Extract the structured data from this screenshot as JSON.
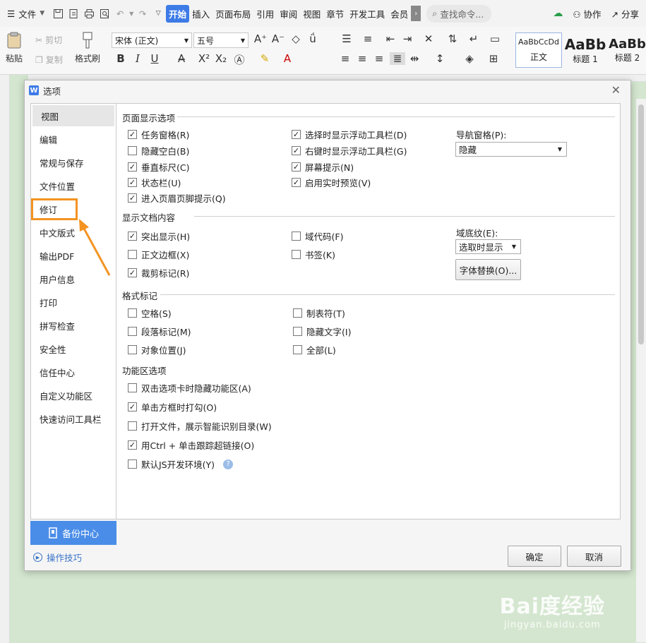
{
  "menubar": {
    "file_label": "文件",
    "tabs": [
      "开始",
      "插入",
      "页面布局",
      "引用",
      "审阅",
      "视图",
      "章节",
      "开发工具",
      "会员"
    ],
    "active_tab": "开始",
    "search_placeholder": "查找命令...",
    "collab_label": "协作",
    "share_label": "分享"
  },
  "ribbon": {
    "paste_label": "粘贴",
    "cut_label": "剪切",
    "copy_label": "复制",
    "format_painter_label": "格式刷",
    "font_family": "宋体 (正文)",
    "font_size": "五号",
    "styles": [
      {
        "preview": "AaBbCcDd",
        "name": "正文"
      },
      {
        "preview": "AaBb",
        "name": "标题 1"
      },
      {
        "preview": "AaBb",
        "name": "标题 2"
      }
    ]
  },
  "dialog": {
    "title": "选项",
    "sidebar": [
      "视图",
      "编辑",
      "常规与保存",
      "文件位置",
      "修订",
      "中文版式",
      "输出PDF",
      "用户信息",
      "打印",
      "拼写检查",
      "安全性",
      "信任中心",
      "自定义功能区",
      "快速访问工具栏"
    ],
    "selected": "视图",
    "backup_label": "备份中心",
    "tips_label": "操作技巧",
    "sections": {
      "page_display": {
        "title": "页面显示选项",
        "col1": [
          {
            "label": "任务窗格(R)",
            "checked": true
          },
          {
            "label": "隐藏空白(B)",
            "checked": false
          },
          {
            "label": "垂直标尺(C)",
            "checked": true
          },
          {
            "label": "状态栏(U)",
            "checked": true
          },
          {
            "label": "进入页眉页脚提示(Q)",
            "checked": true
          }
        ],
        "col2": [
          {
            "label": "选择时显示浮动工具栏(D)",
            "checked": true
          },
          {
            "label": "右键时显示浮动工具栏(G)",
            "checked": true
          },
          {
            "label": "屏幕提示(N)",
            "checked": true
          },
          {
            "label": "启用实时预览(V)",
            "checked": true
          }
        ],
        "nav_label": "导航窗格(P):",
        "nav_value": "隐藏"
      },
      "doc_content": {
        "title": "显示文档内容",
        "col1": [
          {
            "label": "突出显示(H)",
            "checked": true
          },
          {
            "label": "正文边框(X)",
            "checked": false
          },
          {
            "label": "裁剪标记(R)",
            "checked": true
          }
        ],
        "col2": [
          {
            "label": "域代码(F)",
            "checked": false
          },
          {
            "label": "书签(K)",
            "checked": false
          }
        ],
        "shading_label": "域底纹(E):",
        "shading_value": "选取时显示",
        "font_sub_button": "字体替换(O)..."
      },
      "format_marks": {
        "title": "格式标记",
        "col1": [
          {
            "label": "空格(S)",
            "checked": false
          },
          {
            "label": "段落标记(M)",
            "checked": false
          },
          {
            "label": "对象位置(J)",
            "checked": false
          }
        ],
        "col2": [
          {
            "label": "制表符(T)",
            "checked": false
          },
          {
            "label": "隐藏文字(I)",
            "checked": false
          },
          {
            "label": "全部(L)",
            "checked": false
          }
        ]
      },
      "ribbon_opts": {
        "title": "功能区选项",
        "items": [
          {
            "label": "双击选项卡时隐藏功能区(A)",
            "checked": false
          },
          {
            "label": "单击方框时打勾(O)",
            "checked": true
          },
          {
            "label": "打开文件，展示智能识别目录(W)",
            "checked": false
          },
          {
            "label": "用Ctrl + 单击跟踪超链接(O)",
            "checked": true
          },
          {
            "label": "默认JS开发环境(Y)",
            "checked": false
          }
        ]
      }
    },
    "ok_label": "确定",
    "cancel_label": "取消"
  },
  "watermark": {
    "main": "Bai度经验",
    "sub": "jingyan.baidu.com"
  },
  "colors": {
    "accent": "#3d7be7",
    "highlight": "#f39322",
    "page_bg": "#d4e6cf"
  }
}
